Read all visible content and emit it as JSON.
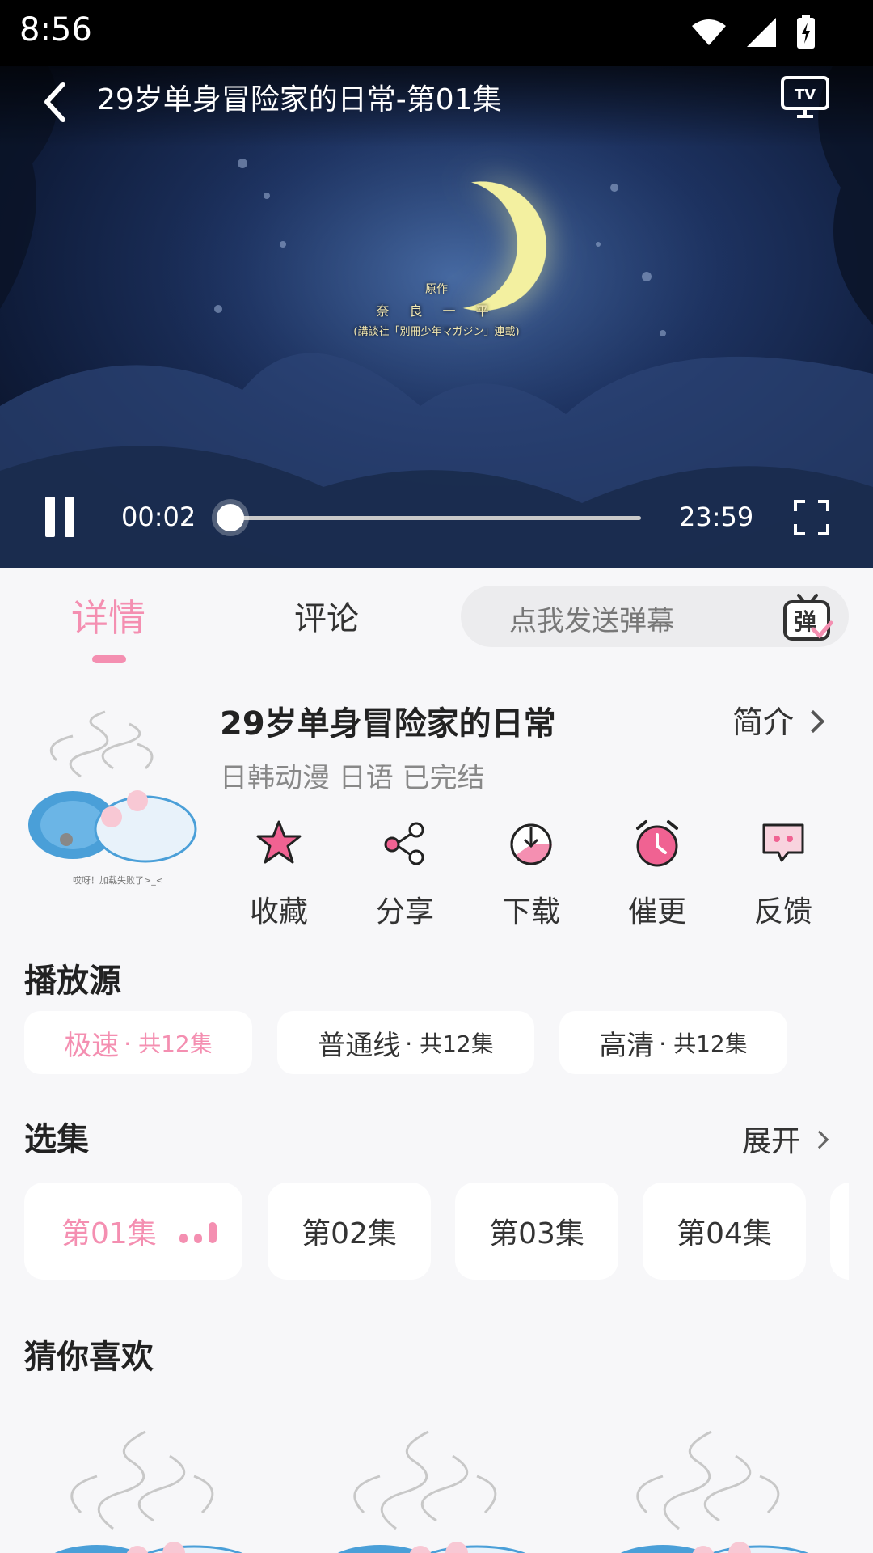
{
  "status_bar": {
    "time": "8:56"
  },
  "player": {
    "title": "29岁单身冒险家的日常-第01集",
    "credit": {
      "line1": "原作",
      "line2": "奈 良 一 平",
      "line3": "(講談社「別冊少年マガジン」連載)"
    },
    "current_time": "00:02",
    "total_time": "23:59",
    "progress": 0.0
  },
  "tabs": {
    "details": "详情",
    "comments": "评论"
  },
  "danmaku": {
    "placeholder": "点我发送弹幕",
    "icon_text": "弹"
  },
  "show": {
    "title": "29岁单身冒险家的日常",
    "intro_label": "简介",
    "meta": "日韩动漫 日语 已完结",
    "poster_caption": "哎呀！加载失败了>_<"
  },
  "actions": [
    {
      "label": "收藏",
      "icon": "star-icon"
    },
    {
      "label": "分享",
      "icon": "share-icon"
    },
    {
      "label": "下载",
      "icon": "download-icon"
    },
    {
      "label": "催更",
      "icon": "alarm-clock-icon"
    },
    {
      "label": "反馈",
      "icon": "feedback-icon"
    }
  ],
  "sources": {
    "title": "播放源",
    "items": [
      {
        "name": "极速",
        "count": "· 共12集",
        "active": true
      },
      {
        "name": "普通线",
        "count": "· 共12集",
        "active": false
      },
      {
        "name": "高清",
        "count": "· 共12集",
        "active": false
      }
    ]
  },
  "episodes": {
    "title": "选集",
    "expand_label": "展开",
    "items": [
      "第01集",
      "第02集",
      "第03集",
      "第04集"
    ]
  },
  "recommend": {
    "title": "猜你喜欢"
  },
  "colors": {
    "accent": "#f48fb1",
    "background": "#f7f7f9"
  }
}
